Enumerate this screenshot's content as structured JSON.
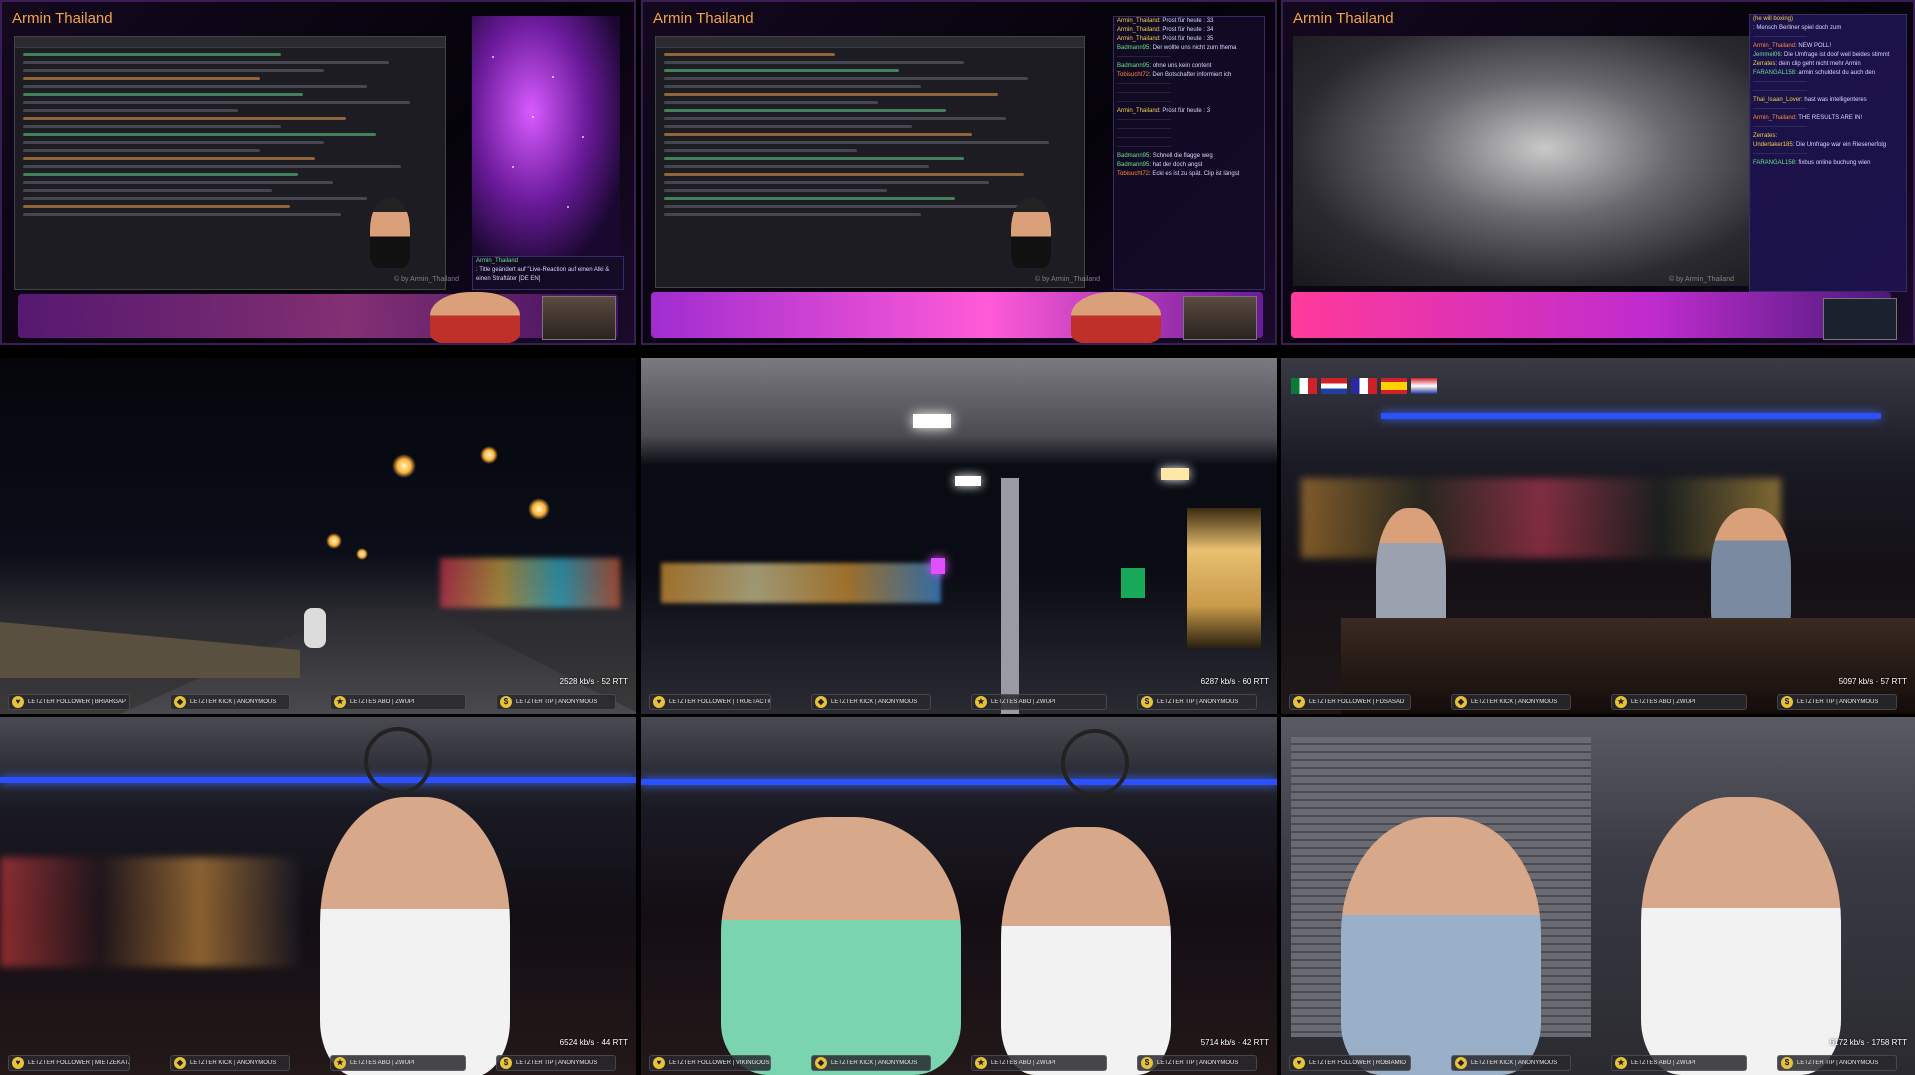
{
  "streams": [
    {
      "title": "Armin Thailand",
      "watermark": "© by Armin_Thailand"
    },
    {
      "title": "Armin Thailand",
      "watermark": "© by Armin_Thailand"
    },
    {
      "title": "Armin Thailand",
      "watermark": "© by Armin_Thailand"
    }
  ],
  "chat2": [
    {
      "user": "Armin_Thailand",
      "text": ": Prost für heute : 33"
    },
    {
      "user": "Armin_Thailand",
      "text": ": Prost für heute : 34"
    },
    {
      "user": "Armin_Thailand",
      "text": ": Prost für heute : 35"
    },
    {
      "user": "Badmann95",
      "text": ": Der wollte uns nicht zum thema"
    },
    {
      "user": "Badmann95",
      "text": ": ohne uns kein content"
    },
    {
      "user": "Tobisucht72",
      "text": ": Den Botschafter informiert ich"
    },
    {
      "user": "Armin_Thailand",
      "text": ": Prost für heute : 3"
    },
    {
      "user": "Badmann95",
      "text": ": Schnell die flagge weg"
    },
    {
      "user": "Badmann95",
      "text": ": hat der doch angst"
    },
    {
      "user": "Tobisucht72",
      "text": ": Ecki es ist zu spät. Clip ist längst"
    }
  ],
  "chat3": [
    {
      "user": "(he will boxing)",
      "text": ""
    },
    {
      "user": "",
      "text": ": Mensch Berliner spiel doch zum"
    },
    {
      "user": "Armin_Thailand",
      "text": ": NEW POLL!"
    },
    {
      "user": "Jemmel06",
      "text": ": Die Umfrage ist doof weil beides stimmt"
    },
    {
      "user": "Zerrates",
      "text": ": dein clip geht nicht mehr Armin"
    },
    {
      "user": "FARANGAL158",
      "text": ": armin schuldest du auch den"
    },
    {
      "user": "Thai_Isaan_Lover",
      "text": ": hast was intelligenteres"
    },
    {
      "user": "Armin_Thailand",
      "text": ": THE RESULTS ARE IN!"
    },
    {
      "user": "Zerrates",
      "text": ":"
    },
    {
      "user": "Undertaker185",
      "text": ": Die Umfrage war ein Riesenerfolg"
    },
    {
      "user": "FARANGAL158",
      "text": ": fixbus online buchung wien"
    }
  ],
  "chat1_alert": {
    "user": "Armin_Thailand",
    "text": ": Title geändert auf \"Live-Reaction auf einen Alki & einen Straftäter [DE EN]"
  },
  "cams": [
    {
      "rtt": "2528 kb/s · 52 RTT",
      "follower": "LETZTER FOLLOWER | BRIARGAP",
      "kick": "LETZTER KICK | ANONYMOUS",
      "abo": "LETZTES ABO | ZWUPI",
      "tip": "LETZTER TIP | ANONYMOUS"
    },
    {
      "rtt": "6287 kb/s · 60 RTT",
      "follower": "LETZTER FOLLOWER | TRUETACTICIAN",
      "kick": "LETZTER KICK | ANONYMOUS",
      "abo": "LETZTES ABO | ZWUPI",
      "tip": "LETZTER TIP | ANONYMOUS"
    },
    {
      "rtt": "5097 kb/s · 57 RTT",
      "follower": "LETZTER FOLLOWER | FDSASAD",
      "kick": "LETZTER KICK | ANONYMOUS",
      "abo": "LETZTES ABO | ZWUPI",
      "tip": "LETZTER TIP | ANONYMOUS"
    },
    {
      "rtt": "6524 kb/s · 44 RTT",
      "follower": "LETZTER FOLLOWER | MIETZEKATZENBANDE",
      "kick": "LETZTER KICK | ANONYMOUS",
      "abo": "LETZTES ABO | ZWUPI",
      "tip": "LETZTER TIP | ANONYMOUS"
    },
    {
      "rtt": "5714 kb/s · 42 RTT",
      "follower": "LETZTER FOLLOWER | VIKINGOOS",
      "kick": "LETZTER KICK | ANONYMOUS",
      "abo": "LETZTES ABO | ZWUPI",
      "tip": "LETZTER TIP | ANONYMOUS"
    },
    {
      "rtt": "6172 kb/s · 1758 RTT",
      "follower": "LETZTER FOLLOWER | ROBIAMIO",
      "kick": "LETZTER KICK | ANONYMOUS",
      "abo": "LETZTES ABO | ZWUPI",
      "tip": "LETZTER TIP | ANONYMOUS"
    }
  ],
  "icons": {
    "follower": "heart-icon",
    "kick": "kick-icon",
    "abo": "star-icon",
    "tip": "dollar-icon"
  },
  "colors": {
    "accent": "#f2a54a",
    "purple": "#a02ccf",
    "neon_blue": "#2a50ff"
  }
}
